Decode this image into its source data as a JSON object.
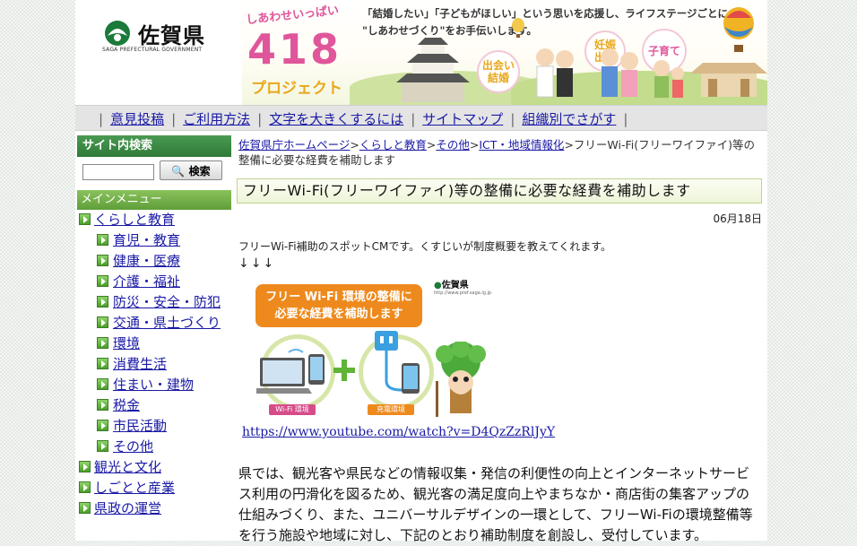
{
  "header": {
    "logo_text": "佐賀県",
    "logo_sub": "SAGA PREFECTURAL GOVERNMENT",
    "banner": {
      "catch": "しあわせいっぱい",
      "number": "418",
      "project": "プロジェクト",
      "message_line1": "「結婚したい」「子どもがほしい」という思いを応援し、ライフステージごとに",
      "message_line2": "\"しあわせづくり\"をお手伝いします。",
      "circle1": "出会い\n結婚",
      "circle2": "妊娠\n出産",
      "circle3": "子育て"
    }
  },
  "gnav": {
    "items": [
      "意見投稿",
      "ご利用方法",
      "文字を大きくするには",
      "サイトマップ",
      "組織別でさがす"
    ]
  },
  "sidebar": {
    "search_title": "サイト内検索",
    "search_button": "検索",
    "search_value": "",
    "menu_title": "メインメニュー",
    "menu": [
      {
        "label": "くらしと教育",
        "level": "top"
      },
      {
        "label": "育児・教育",
        "level": "sub"
      },
      {
        "label": "健康・医療",
        "level": "sub"
      },
      {
        "label": "介護・福祉",
        "level": "sub"
      },
      {
        "label": "防災・安全・防犯",
        "level": "sub"
      },
      {
        "label": "交通・県土づくり",
        "level": "sub"
      },
      {
        "label": "環境",
        "level": "sub"
      },
      {
        "label": "消費生活",
        "level": "sub"
      },
      {
        "label": "住まい・建物",
        "level": "sub"
      },
      {
        "label": "税金",
        "level": "sub"
      },
      {
        "label": "市民活動",
        "level": "sub"
      },
      {
        "label": "その他",
        "level": "sub"
      },
      {
        "label": "観光と文化",
        "level": "top"
      },
      {
        "label": "しごとと産業",
        "level": "top"
      },
      {
        "label": "県政の運営",
        "level": "top"
      }
    ]
  },
  "breadcrumb": {
    "links": [
      "佐賀県庁ホームページ",
      "くらしと教育",
      "その他",
      "ICT・地域情報化"
    ],
    "separator": ">",
    "current": "フリーWi-Fi(フリーワイファイ)等の整備に必要な経費を補助します"
  },
  "article": {
    "title": "フリーWi-Fi(フリーワイファイ)等の整備に必要な経費を補助します",
    "date": "06月18日",
    "intro": "フリーWi-Fi補助のスポットCMです。くすじいが制度概要を教えてくれます。",
    "arrows": "↓↓↓",
    "flyer": {
      "title_line1": "フリー Wi-Fi 環境の整備に",
      "title_line2": "必要な経費を補助します",
      "logo": "佐賀県",
      "logo_url_text": "http://www.pref.saga.lg.jp",
      "tag_wifi": "Wi-Fi 環境",
      "tag_charge": "充電環境"
    },
    "youtube_link": "https://www.youtube.com/watch?v=D4QzZzRlJyY",
    "body": "県では、観光客や県民などの情報収集・発信の利便性の向上とインターネットサービス利用の円滑化を図るため、観光客の満足度向上やまちなか・商店街の集客アップの仕組みづくり、また、ユニバーサルデザインの一環として、フリーWi-Fiの環境整備等を行う施設や地域に対し、下記のとおり補助制度を創設し、受付しています。"
  }
}
